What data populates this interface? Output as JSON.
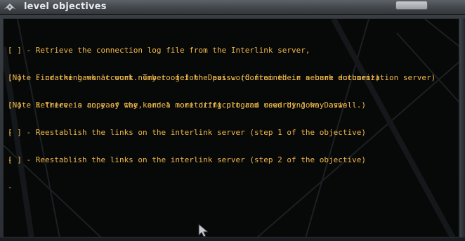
{
  "window": {
    "title": "level objectives",
    "icon": "winged-logo-icon",
    "close_control": "window-button"
  },
  "objectives": [
    {
      "checkbox": "[ ]",
      "lines": [
        "[ ] - Retrieve the connection log file from the Interlink server,",
        "(Note : cracking won't work. Try to get the password from their secure authorization server)"
      ]
    },
    {
      "checkbox": "[ ]",
      "lines": [
        "[ ] - Find the bank account number of John Davis. (Contained in a bank document).",
        "(Note : There is an easy way, and a more difficult and rewarding way aswell.)"
      ]
    },
    {
      "checkbox": "[ ]",
      "lines": [
        "[ ] - Retrieve a copy of the kernel monitoring program used by John Davis",
        "-"
      ]
    },
    {
      "checkbox": "[ ]",
      "lines": [
        "[ ] - Reestablish the links on the interlink server (step 1 of the objective)",
        "-"
      ]
    },
    {
      "checkbox": "[ ]",
      "lines": [
        "[ ] - Reestablish the links on the interlink server (step 2 of the objective)",
        "-"
      ]
    }
  ],
  "colors": {
    "text": "#f0b84a",
    "panel_bg": "#070808",
    "titlebar": "#464b50",
    "title_text": "#e8eaec"
  },
  "icons": {
    "mouse_pointer": "arrow-cursor-icon"
  }
}
